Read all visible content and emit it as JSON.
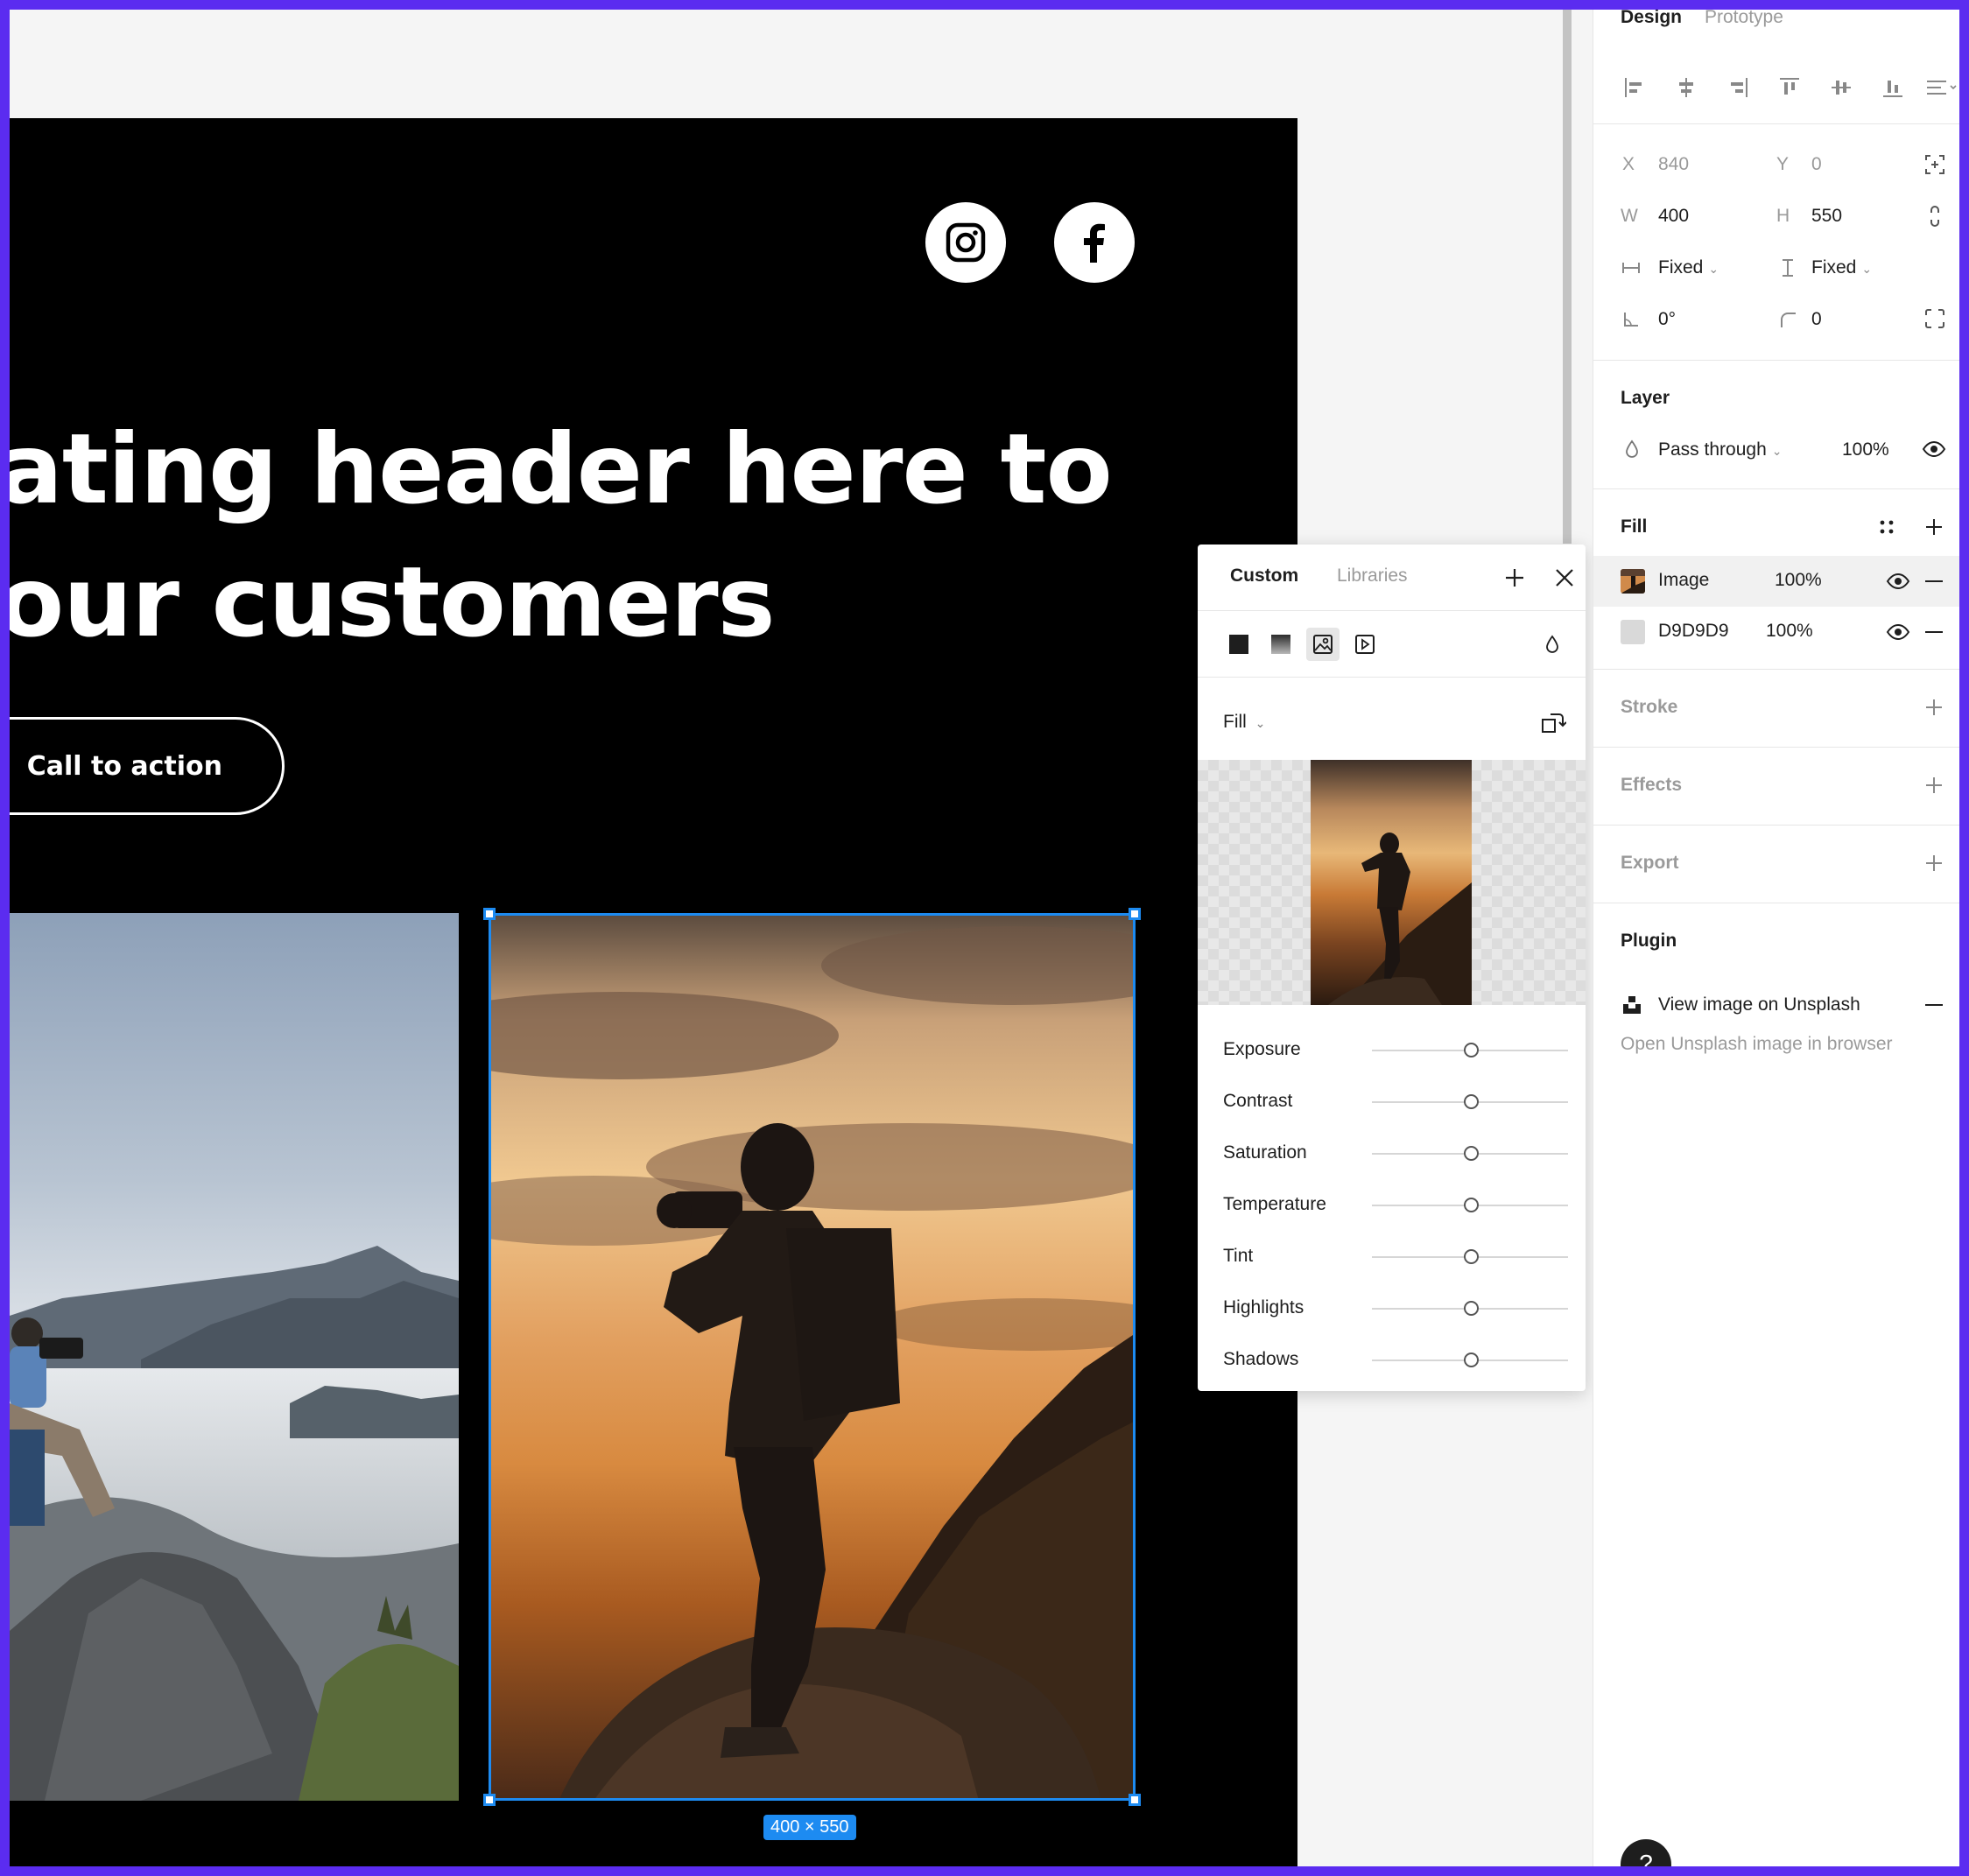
{
  "canvas": {
    "frame_background": "#000000",
    "headline_line1": "ating header here to",
    "headline_line2": "our customers",
    "cta_label": "Call to action",
    "social_icons": [
      "instagram-icon",
      "facebook-icon"
    ],
    "selection_size": "400 × 550",
    "selection_color": "#1d8bf1"
  },
  "panel": {
    "tabs": [
      "Design",
      "Prototype"
    ],
    "align_icons": [
      "align-left-icon",
      "align-horizontal-center-icon",
      "align-right-icon",
      "align-top-icon",
      "align-vertical-center-icon",
      "align-bottom-icon",
      "distribute-icon"
    ],
    "x_label": "X",
    "x_value": "840",
    "y_label": "Y",
    "y_value": "0",
    "w_label": "W",
    "w_value": "400",
    "h_label": "H",
    "h_value": "550",
    "width_mode": "Fixed",
    "height_mode": "Fixed",
    "rotation": "0°",
    "radius": "0",
    "layer": {
      "title": "Layer",
      "blend": "Pass through",
      "opacity": "100%"
    },
    "fill": {
      "title": "Fill",
      "items": [
        {
          "name": "Image",
          "opacity": "100%"
        },
        {
          "name": "D9D9D9",
          "opacity": "100%",
          "color": "#D9D9D9"
        }
      ]
    },
    "stroke_title": "Stroke",
    "effects_title": "Effects",
    "export_title": "Export",
    "plugin": {
      "title": "Plugin",
      "action": "View image on Unsplash",
      "description": "Open Unsplash image in browser"
    },
    "help": "?"
  },
  "popover": {
    "tabs": [
      "Custom",
      "Libraries"
    ],
    "fill_mode": "Fill",
    "adjustments": [
      {
        "label": "Exposure",
        "value": 0
      },
      {
        "label": "Contrast",
        "value": 0
      },
      {
        "label": "Saturation",
        "value": 0
      },
      {
        "label": "Temperature",
        "value": 0
      },
      {
        "label": "Tint",
        "value": 0
      },
      {
        "label": "Highlights",
        "value": 0
      },
      {
        "label": "Shadows",
        "value": 0
      }
    ]
  }
}
